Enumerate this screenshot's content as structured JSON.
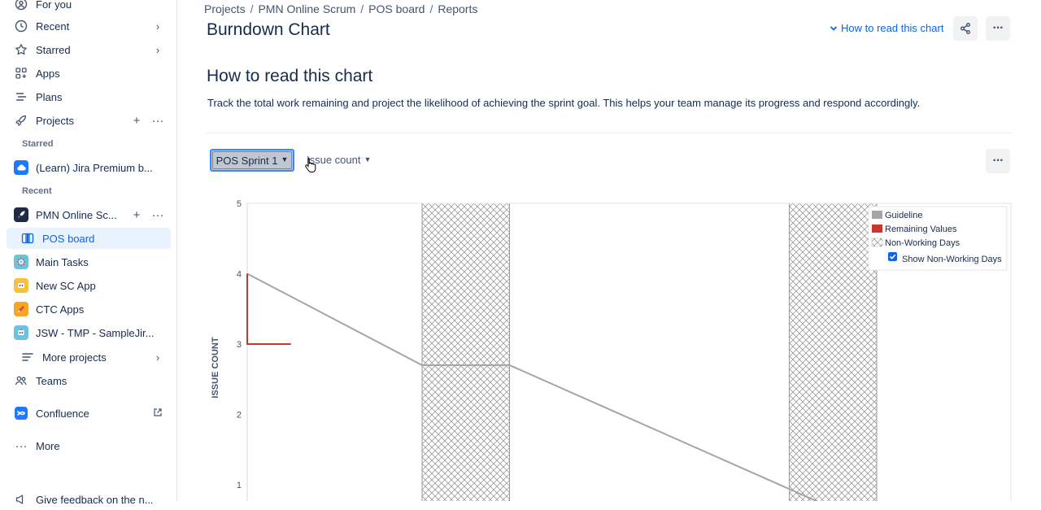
{
  "sidebar": {
    "for_you": "For you",
    "recent": "Recent",
    "starred": "Starred",
    "apps": "Apps",
    "plans": "Plans",
    "projects": "Projects",
    "section_starred": "Starred",
    "starred_project": "(Learn) Jira Premium b...",
    "section_recent": "Recent",
    "recent_project_1": "PMN Online Sc...",
    "board": "POS board",
    "recent_project_2": "Main Tasks",
    "recent_project_3": "New SC App",
    "recent_project_4": "CTC Apps",
    "recent_project_5": "JSW - TMP - SampleJir...",
    "more_projects": "More projects",
    "teams": "Teams",
    "confluence": "Confluence",
    "more": "More",
    "feedback": "Give feedback on the n..."
  },
  "breadcrumb": [
    "Projects",
    "PMN Online Scrum",
    "POS board",
    "Reports"
  ],
  "page_title": "Burndown Chart",
  "help_link": "How to read this chart",
  "section": {
    "title": "How to read this chart",
    "description": "Track the total work remaining and project the likelihood of achieving the sprint goal. This helps your team manage its progress and respond accordingly."
  },
  "controls": {
    "sprint": "POS Sprint 1",
    "estimation": "Issue count"
  },
  "colors": {
    "accent": "#0c66e4",
    "guideline": "#a5a5a5",
    "remaining": "#c9372c"
  },
  "chart_data": {
    "type": "line",
    "ylabel": "ISSUE COUNT",
    "ylim": [
      0,
      5
    ],
    "yticks": [
      1,
      2,
      3,
      4,
      5
    ],
    "series": [
      {
        "name": "Guideline",
        "points": [
          [
            0,
            4
          ],
          [
            1,
            2.7
          ],
          [
            1.5,
            2.7
          ],
          [
            3.5,
            0.5
          ]
        ]
      },
      {
        "name": "Remaining Values",
        "points": [
          [
            0,
            4
          ],
          [
            0,
            3
          ],
          [
            0.25,
            3
          ]
        ]
      }
    ],
    "non_working_days": [
      [
        1,
        1.5
      ],
      [
        3.1,
        3.6
      ]
    ],
    "legend": {
      "position": "top-right",
      "items": [
        "Guideline",
        "Remaining Values",
        "Non-Working Days"
      ],
      "checkbox_label": "Show Non-Working Days",
      "checkbox_checked": true
    }
  }
}
